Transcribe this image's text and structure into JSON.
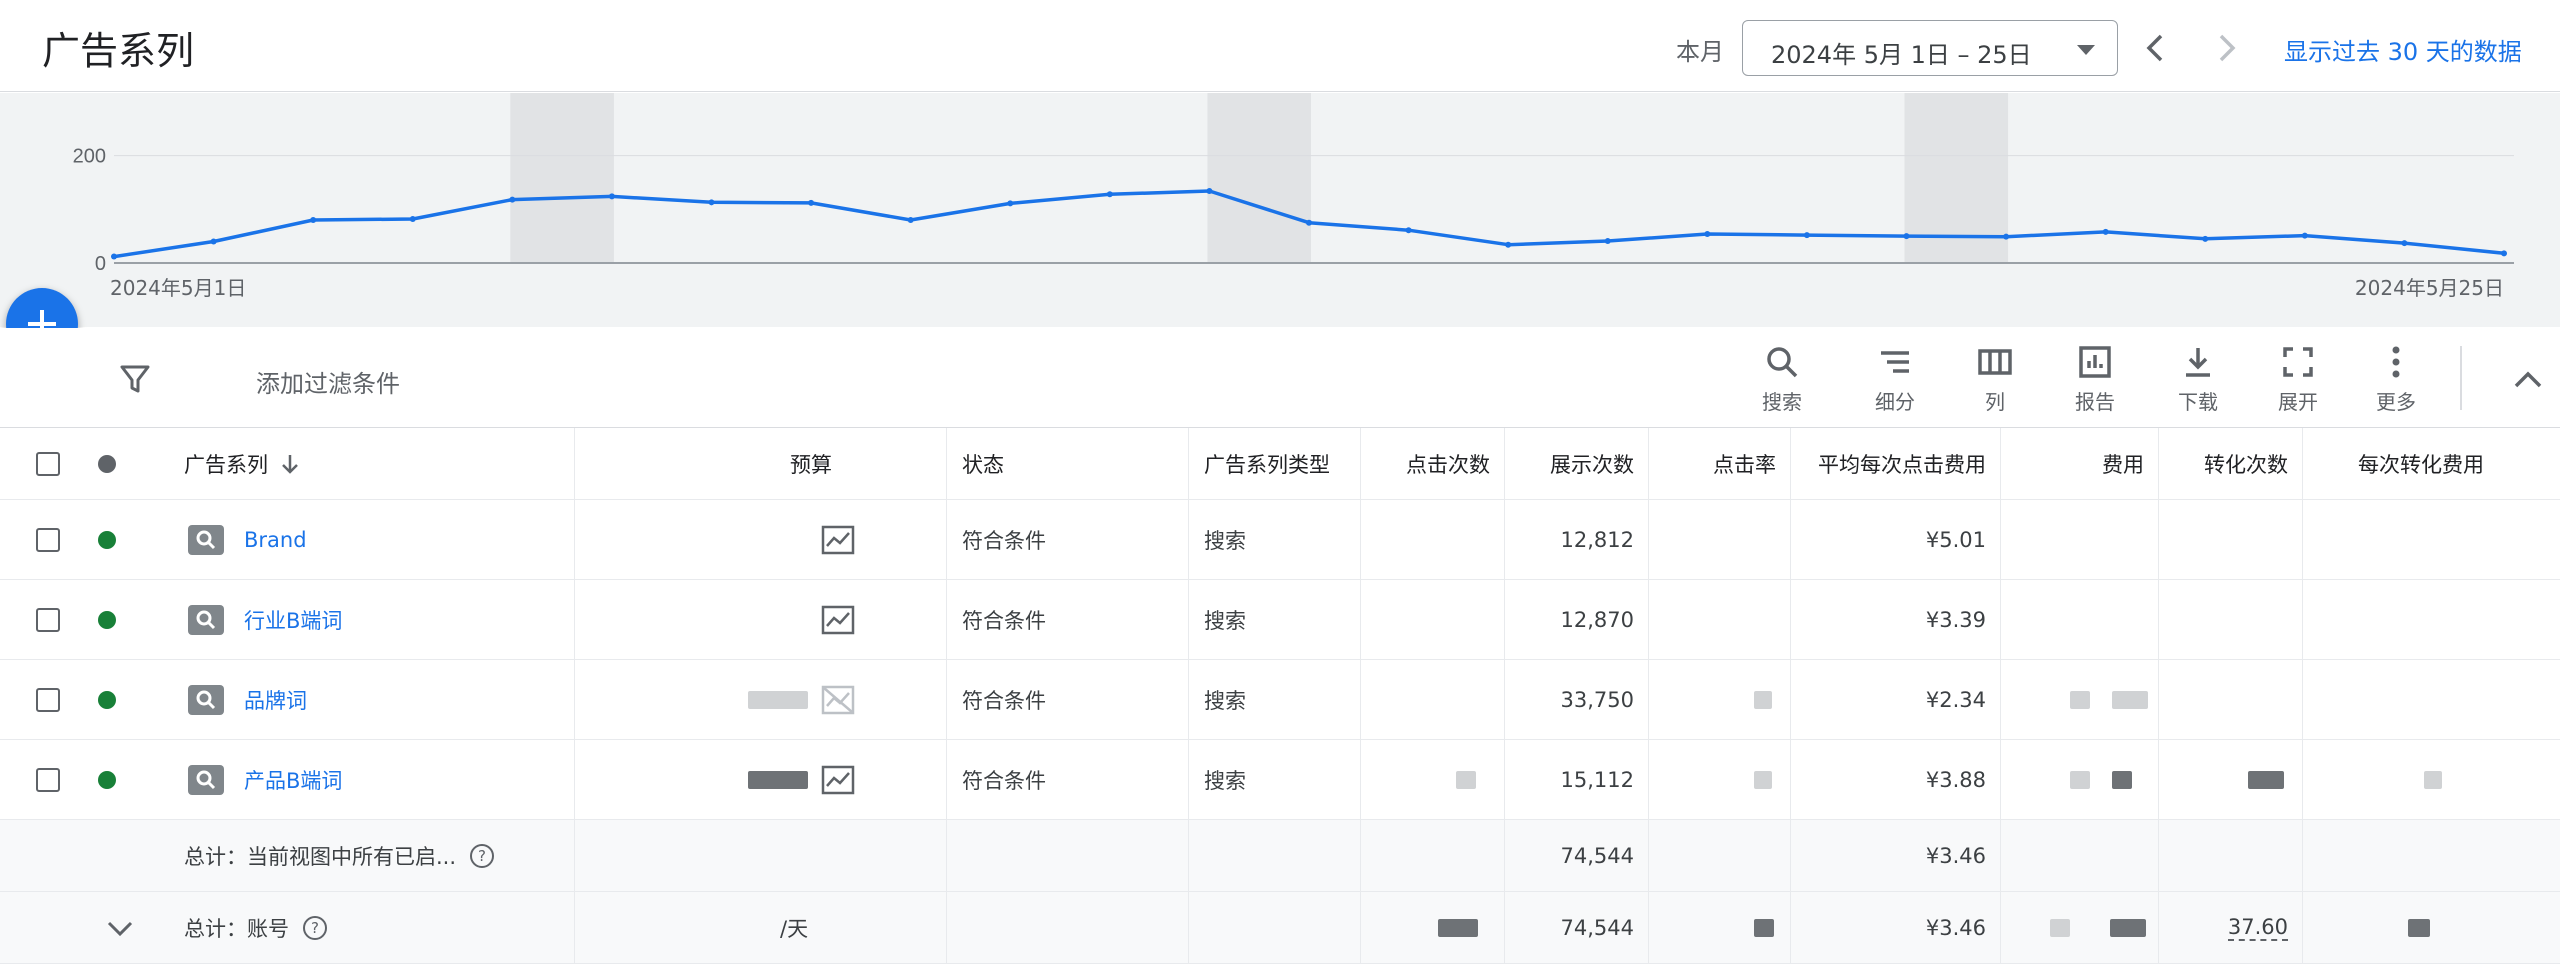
{
  "header": {
    "title": "广告系列",
    "period_label": "本月",
    "date_range": "2024年 5月 1日 – 25日",
    "show_30_days": "显示过去 30 天的数据"
  },
  "chart_data": {
    "type": "line",
    "x_start_label": "2024年5月1日",
    "x_end_label": "2024年5月25日",
    "y_ticks": [
      "200",
      "0"
    ],
    "ylim": [
      0,
      270
    ],
    "series": [
      {
        "values": [
          12,
          40,
          80,
          82,
          118,
          124,
          113,
          112,
          80,
          111,
          128,
          134,
          75,
          61,
          34,
          41,
          54,
          52,
          50,
          49,
          58,
          45,
          51,
          37,
          18
        ]
      }
    ],
    "shaded_bands": [
      4,
      11,
      18
    ],
    "color": "#1a73e8"
  },
  "toolbar": {
    "filter_label": "添加过滤条件",
    "tools": [
      {
        "label": "搜索",
        "icon": "search-icon"
      },
      {
        "label": "细分",
        "icon": "segment-icon"
      },
      {
        "label": "列",
        "icon": "columns-icon"
      },
      {
        "label": "报告",
        "icon": "report-icon"
      },
      {
        "label": "下载",
        "icon": "download-icon"
      },
      {
        "label": "展开",
        "icon": "fullscreen-icon"
      },
      {
        "label": "更多",
        "icon": "more-vert-icon"
      }
    ]
  },
  "table": {
    "headers": {
      "campaign": "广告系列",
      "budget": "预算",
      "status": "状态",
      "type": "广告系列类型",
      "clicks": "点击次数",
      "impressions": "展示次数",
      "ctr": "点击率",
      "avg_cpc": "平均每次点击费用",
      "cost": "费用",
      "conversions": "转化次数",
      "cost_per_conv": "每次转化费用"
    },
    "rows": [
      {
        "name": "Brand",
        "status": "符合条件",
        "type": "搜索",
        "impressions": "12,812",
        "avg_cpc": "¥5.01"
      },
      {
        "name": "行业B端词",
        "status": "符合条件",
        "type": "搜索",
        "impressions": "12,870",
        "avg_cpc": "¥3.39"
      },
      {
        "name": "品牌词",
        "status": "符合条件",
        "type": "搜索",
        "impressions": "33,750",
        "avg_cpc": "¥2.34"
      },
      {
        "name": "产品B端词",
        "status": "符合条件",
        "type": "搜索",
        "impressions": "15,112",
        "avg_cpc": "¥3.88"
      }
    ],
    "totals": [
      {
        "label": "总计：当前视图中所有已启...",
        "impressions": "74,544",
        "avg_cpc": "¥3.46"
      },
      {
        "label": "总计：账号",
        "budget": "/天",
        "impressions": "74,544",
        "avg_cpc": "¥3.46",
        "conversions": "37.60"
      }
    ],
    "status_color": "#188038",
    "header_dot_color": "#5f6368"
  }
}
